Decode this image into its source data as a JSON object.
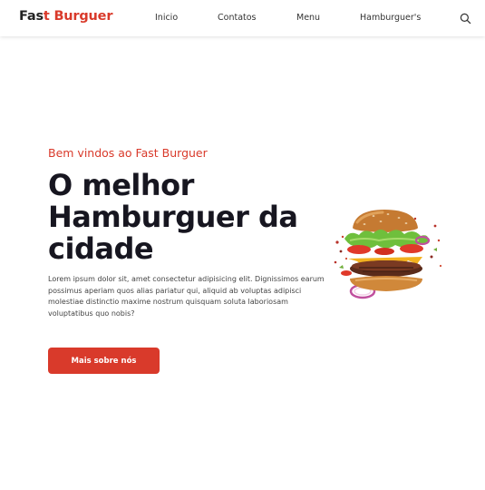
{
  "brand": {
    "part_a": "Fas",
    "part_b": "t Burguer"
  },
  "nav": {
    "items": [
      {
        "label": "Inicio"
      },
      {
        "label": "Contatos"
      },
      {
        "label": "Menu"
      },
      {
        "label": "Hamburguer's"
      }
    ]
  },
  "hero": {
    "subtitle": "Bem vindos ao Fast Burguer",
    "title": "O melhor Hamburguer da cidade",
    "text": "Lorem ipsum dolor sit, amet consectetur adipisicing elit. Dignissimos earum possimus aperiam quos alias pariatur qui, aliquid ab voluptas adipisci molestiae distinctio maxime nostrum quisquam soluta laboriosam voluptatibus quo nobis?",
    "cta_label": "Mais sobre nós"
  },
  "colors": {
    "accent": "#d93a2b",
    "heading": "#171620",
    "navbar_bg": "#ffffff"
  },
  "icons": {
    "search": "search-icon",
    "hero_image": "burger-image"
  }
}
